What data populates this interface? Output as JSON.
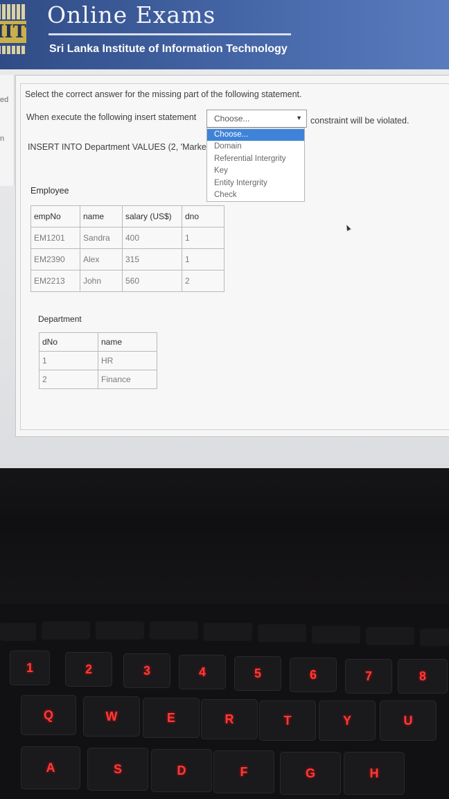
{
  "header": {
    "title": "Online Exams",
    "subtitle": "Sri Lanka Institute of Information Technology",
    "logo_text": "IIT"
  },
  "sidebar_fragments": [
    "ed",
    "n"
  ],
  "question": {
    "instruction": "Select the correct answer for the missing part of the following statement.",
    "prompt_before": "When execute the following insert statement",
    "prompt_after": "constraint will be violated.",
    "statement": "INSERT INTO Department VALUES (2, 'Marketi",
    "select_value": "Choose...",
    "options": [
      "Choose...",
      "Domain",
      "Referential Intergrity",
      "Key",
      "Entity Intergrity",
      "Check"
    ]
  },
  "employee_table": {
    "caption": "Employee",
    "headers": [
      "empNo",
      "name",
      "salary (US$)",
      "dno"
    ],
    "rows": [
      [
        "EM1201",
        "Sandra",
        "400",
        "1"
      ],
      [
        "EM2390",
        "Alex",
        "315",
        "1"
      ],
      [
        "EM2213",
        "John",
        "560",
        "2"
      ]
    ]
  },
  "department_table": {
    "caption": "Department",
    "headers": [
      "dNo",
      "name"
    ],
    "rows": [
      [
        "1",
        "HR"
      ],
      [
        "2",
        "Finance"
      ]
    ]
  },
  "keyboard": {
    "number_row": [
      "1",
      "2",
      "3",
      "4",
      "5",
      "6",
      "7",
      "8"
    ],
    "top_row": [
      "Q",
      "W",
      "E",
      "R",
      "T",
      "Y",
      "U"
    ],
    "home_row": [
      "A",
      "S",
      "D",
      "F",
      "G",
      "H"
    ],
    "glow_color": "#ff3a38"
  }
}
